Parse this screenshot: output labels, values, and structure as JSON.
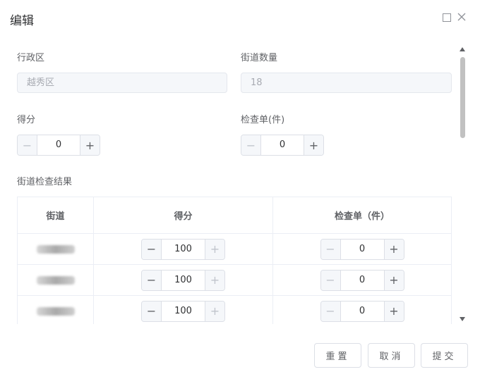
{
  "dialog": {
    "title": "编辑"
  },
  "form": {
    "district_label": "行政区",
    "district_value": "越秀区",
    "street_count_label": "街道数量",
    "street_count_value": "18",
    "score_label": "得分",
    "score_value": "0",
    "checklist_label": "检查单(件)",
    "checklist_value": "0",
    "results_label": "街道检查结果"
  },
  "table": {
    "headers": [
      "街道",
      "得分",
      "检查单（件）"
    ],
    "rows": [
      {
        "street": "",
        "score": "100",
        "checklist": "0"
      },
      {
        "street": "",
        "score": "100",
        "checklist": "0"
      },
      {
        "street": "",
        "score": "100",
        "checklist": "0"
      }
    ]
  },
  "footer": {
    "reset_label": "重置",
    "cancel_label": "取消",
    "submit_label": "提交"
  },
  "icons": {
    "minus": "−",
    "plus": "+"
  }
}
